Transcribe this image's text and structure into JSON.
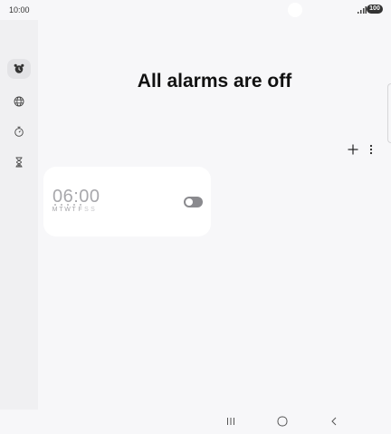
{
  "status_bar": {
    "time": "10:00",
    "battery": "100"
  },
  "rail": {
    "items": [
      {
        "name": "alarm",
        "icon": "alarm-clock-icon",
        "active": true
      },
      {
        "name": "world-clock",
        "icon": "globe-icon",
        "active": false
      },
      {
        "name": "stopwatch",
        "icon": "stopwatch-icon",
        "active": false
      },
      {
        "name": "timer",
        "icon": "hourglass-icon",
        "active": false
      }
    ]
  },
  "main": {
    "title": "All alarms are off",
    "add_icon": "plus-icon",
    "more_icon": "more-vert-icon"
  },
  "alarm": {
    "time": "06:00",
    "enabled": false,
    "days": [
      {
        "letter": "M",
        "selected": true
      },
      {
        "letter": "T",
        "selected": true
      },
      {
        "letter": "W",
        "selected": true
      },
      {
        "letter": "T",
        "selected": true
      },
      {
        "letter": "F",
        "selected": true
      },
      {
        "letter": "S",
        "selected": false
      },
      {
        "letter": "S",
        "selected": false
      }
    ]
  },
  "colors": {
    "background": "#f7f7f9",
    "card": "#ffffff",
    "toggle_off": "#8a8a8e",
    "time_inactive": "#a8a8ac"
  }
}
